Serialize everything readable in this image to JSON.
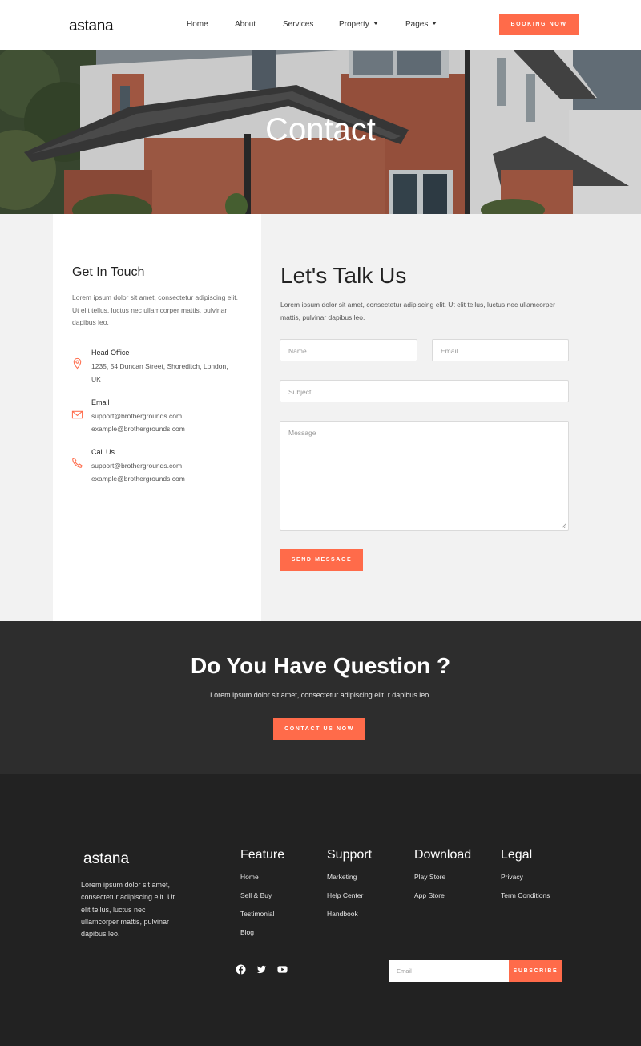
{
  "header": {
    "logo": "astana",
    "nav": [
      {
        "label": "Home",
        "dropdown": false
      },
      {
        "label": "About",
        "dropdown": false
      },
      {
        "label": "Services",
        "dropdown": false
      },
      {
        "label": "Property",
        "dropdown": true
      },
      {
        "label": "Pages",
        "dropdown": true
      }
    ],
    "booking_label": "BOOKING NOW"
  },
  "hero": {
    "title": "Contact"
  },
  "contact_info": {
    "title": "Get In Touch",
    "description": "Lorem ipsum dolor sit amet, consectetur adipiscing elit. Ut elit tellus, luctus nec ullamcorper mattis, pulvinar dapibus leo.",
    "items": [
      {
        "icon": "map-pin-icon",
        "title": "Head Office",
        "lines": [
          "1235, 54 Duncan Street, Shoreditch, London,",
          "UK"
        ]
      },
      {
        "icon": "envelope-icon",
        "title": "Email",
        "lines": [
          "support@brothergrounds.com",
          "example@brothergrounds.com"
        ]
      },
      {
        "icon": "phone-icon",
        "title": "Call Us",
        "lines": [
          "support@brothergrounds.com",
          "example@brothergrounds.com"
        ]
      }
    ]
  },
  "contact_form": {
    "title": "Let's Talk Us",
    "description": "Lorem ipsum dolor sit amet, consectetur adipiscing elit. Ut elit tellus, luctus nec ullamcorper mattis, pulvinar dapibus leo.",
    "name_placeholder": "Name",
    "email_placeholder": "Email",
    "subject_placeholder": "Subject",
    "message_placeholder": "Message",
    "send_label": "SEND MESSAGE"
  },
  "question": {
    "title": "Do You Have Question ?",
    "description": "Lorem ipsum dolor sit amet, consectetur adipiscing elit. r dapibus leo.",
    "button_label": "CONTACT US NOW"
  },
  "footer": {
    "logo": "astana",
    "description": "Lorem ipsum dolor sit amet, consectetur adipiscing elit. Ut elit tellus, luctus nec ullamcorper mattis, pulvinar dapibus leo.",
    "columns": [
      {
        "heading": "Feature",
        "links": [
          "Home",
          "Sell & Buy",
          "Testimonial",
          "Blog"
        ]
      },
      {
        "heading": "Support",
        "links": [
          "Marketing",
          "Help Center",
          "Handbook"
        ]
      },
      {
        "heading": "Download",
        "links": [
          "Play Store",
          "App Store"
        ]
      },
      {
        "heading": "Legal",
        "links": [
          "Privacy",
          "Term Conditions"
        ]
      }
    ],
    "social": [
      "facebook-icon",
      "twitter-icon",
      "youtube-icon"
    ],
    "subscribe_placeholder": "Email",
    "subscribe_label": "SUBSCRIBE"
  },
  "colors": {
    "accent": "#ff6b4a",
    "dark_section": "#2d2d2d",
    "footer": "#222222",
    "light_section": "#f2f2f2"
  }
}
